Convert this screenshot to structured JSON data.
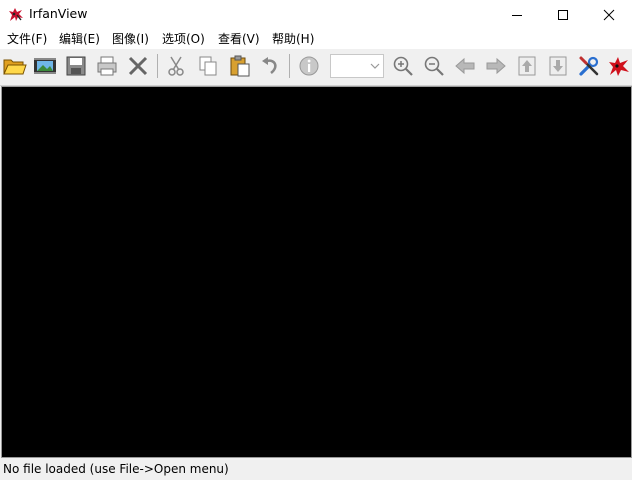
{
  "window": {
    "title": "IrfanView",
    "icon": "irfanview-cat-icon",
    "controls": [
      "minimize-icon",
      "maximize-icon",
      "close-icon"
    ]
  },
  "menu": [
    {
      "label": "文件(F)"
    },
    {
      "label": "编辑(E)"
    },
    {
      "label": "图像(I)"
    },
    {
      "label": "选项(O)"
    },
    {
      "label": "查看(V)"
    },
    {
      "label": "帮助(H)"
    }
  ],
  "toolbar": {
    "buttons": [
      "open-folder-icon",
      "slideshow-icon",
      "save-icon",
      "print-icon",
      "delete-icon",
      "cut-icon",
      "copy-icon",
      "paste-icon",
      "undo-icon",
      "info-icon",
      "zoom-in-icon",
      "zoom-out-icon",
      "previous-icon",
      "next-icon",
      "first-file-icon",
      "last-file-icon",
      "settings-icon",
      "irfanview-about-icon"
    ],
    "zoom_value": ""
  },
  "status": {
    "text": "No file loaded (use File->Open menu)"
  },
  "colors": {
    "viewer_background": "#000000",
    "chrome": "#f0f0f0"
  }
}
